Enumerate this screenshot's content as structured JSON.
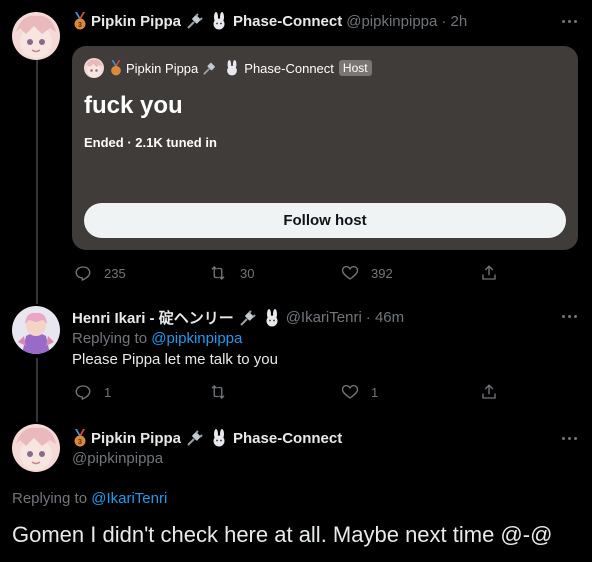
{
  "tweet1": {
    "author_name": "Pipkin Pippa",
    "affiliation": "Phase-Connect",
    "handle": "@pipkinpippa",
    "time": "· 2h",
    "space": {
      "author_name": "Pipkin Pippa",
      "affiliation": "Phase-Connect",
      "host_badge": "Host",
      "title": "fuck you",
      "status": "Ended · 2.1K tuned in",
      "follow_label": "Follow host"
    },
    "actions": {
      "replies": "235",
      "retweets": "30",
      "likes": "392"
    }
  },
  "tweet2": {
    "author_name": "Henri Ikari - 碇ヘンリー",
    "handle": "@IkariTenri",
    "time": "· 46m",
    "replying_prefix": "Replying to",
    "replying_handle": "@pipkinpippa",
    "text": "Please Pippa let me talk to you",
    "actions": {
      "replies": "1",
      "retweets": "",
      "likes": "1"
    }
  },
  "tweet3": {
    "author_name": "Pipkin Pippa",
    "affiliation": "Phase-Connect",
    "handle": "@pipkinpippa",
    "replying_prefix": "Replying to",
    "replying_handle": "@IkariTenri",
    "text": "Gomen I didn't check here at all. Maybe next time @-@"
  },
  "icons": [
    "medal-icon",
    "plug-icon",
    "rabbit-icon",
    "more-icon",
    "reply-icon",
    "retweet-icon",
    "like-icon",
    "share-icon"
  ],
  "colors": {
    "background": "#000000",
    "card": "#403c39",
    "link": "#1d9bf0",
    "muted": "#71767b",
    "text": "#e7e9ea"
  }
}
